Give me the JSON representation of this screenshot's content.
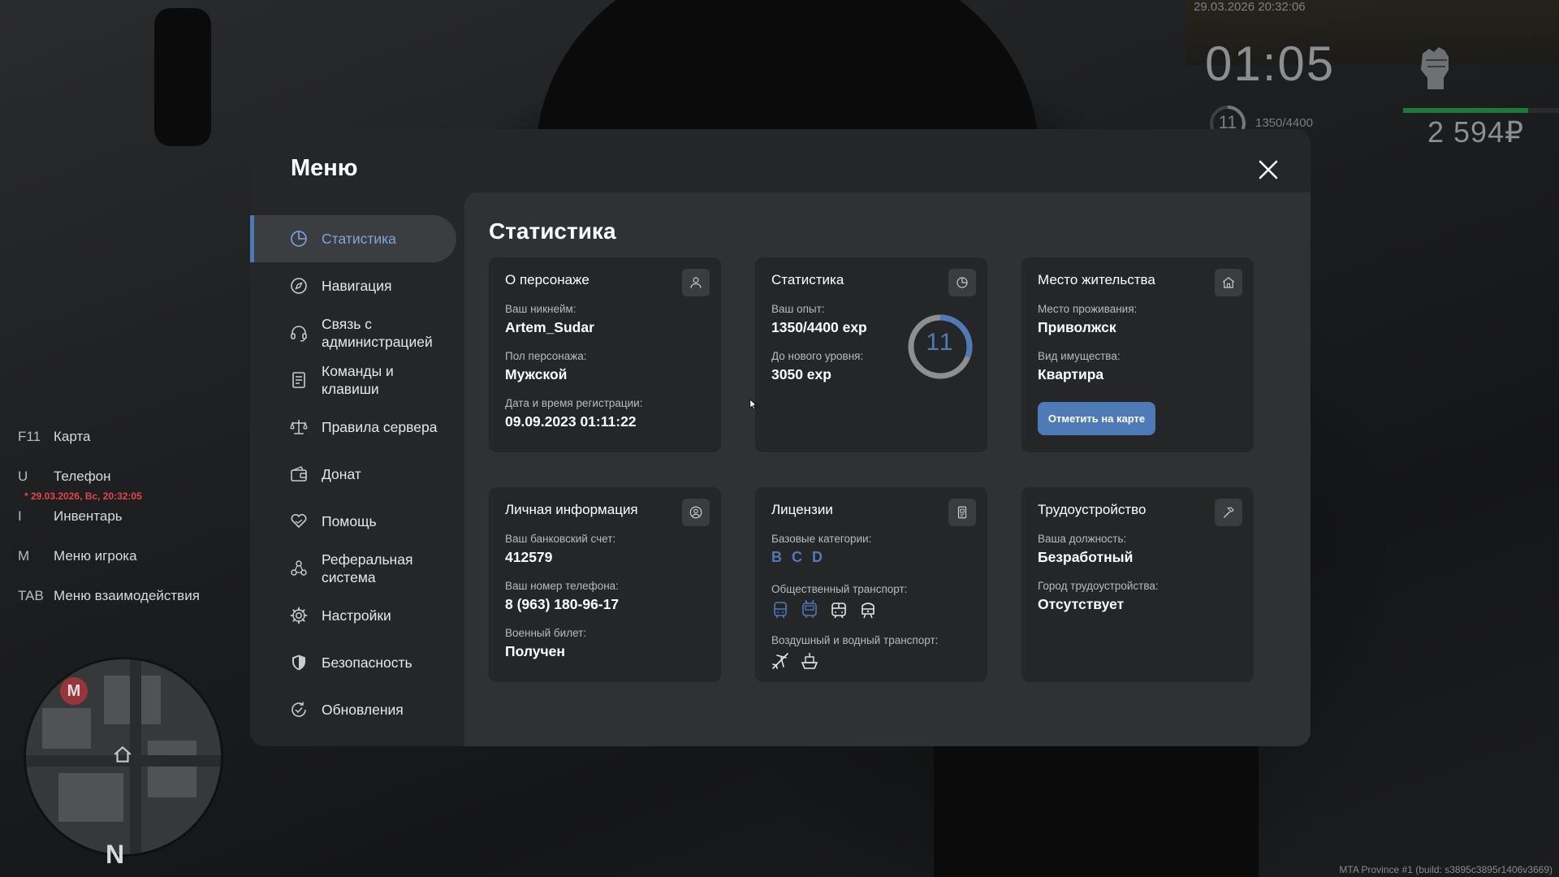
{
  "hud": {
    "datetime": "29.03.2026 20:32:06",
    "clock": "01:05",
    "level": "11",
    "exp": "1350/4400",
    "money": "2 594₽",
    "health_fraction": 0.8
  },
  "hotkeys": [
    {
      "key": "F11",
      "label": "Карта"
    },
    {
      "key": "U",
      "label": "Телефон"
    },
    {
      "key": "I",
      "label": "Инвентарь"
    },
    {
      "key": "M",
      "label": "Меню игрока"
    },
    {
      "key": "TAB",
      "label": "Меню взаимодействия"
    }
  ],
  "hotkey_note": "* 29.03.2026, Вс, 20:32:05",
  "minimap": {
    "metro_label": "M",
    "compass": "N"
  },
  "build_info": "MTA Province #1 (build: s3895c3895r1406v3669)",
  "menu": {
    "title": "Меню",
    "close_icon": "close-icon",
    "nav": [
      {
        "label": "Статистика",
        "icon": "pie-chart-icon",
        "active": true
      },
      {
        "label": "Навигация",
        "icon": "compass-icon"
      },
      {
        "label": "Связь с\nадминистрацией",
        "icon": "headset-icon"
      },
      {
        "label": "Команды и\nклавиши",
        "icon": "document-list-icon"
      },
      {
        "label": "Правила сервера",
        "icon": "scales-icon"
      },
      {
        "label": "Донат",
        "icon": "wallet-icon"
      },
      {
        "label": "Помощь",
        "icon": "heart-hands-icon"
      },
      {
        "label": "Реферальная\nсистема",
        "icon": "people-network-icon"
      },
      {
        "label": "Настройки",
        "icon": "gear-icon"
      },
      {
        "label": "Безопасность",
        "icon": "shield-icon"
      },
      {
        "label": "Обновления",
        "icon": "refresh-check-icon"
      }
    ]
  },
  "content": {
    "title": "Статистика",
    "about": {
      "title": "О персонаже",
      "icon": "user-icon",
      "nick_label": "Ваш никнейм:",
      "nick": "Artem_Sudar",
      "gender_label": "Пол персонажа:",
      "gender": "Мужской",
      "reg_label": "Дата и время регистрации:",
      "reg": "09.09.2023 01:11:22"
    },
    "stats": {
      "title": "Статистика",
      "icon": "pie-chart-icon",
      "exp_label": "Ваш опыт:",
      "exp": "1350/4400 exp",
      "next_label": "До нового уровня:",
      "next": "3050 exp",
      "level": "11",
      "progress": 0.307
    },
    "residence": {
      "title": "Место жительства",
      "icon": "house-icon",
      "place_label": "Место проживания:",
      "place": "Приволжск",
      "type_label": "Вид имущества:",
      "type": "Квартира",
      "button": "Отметить на карте"
    },
    "personal": {
      "title": "Личная информация",
      "icon": "user-circle-icon",
      "bank_label": "Ваш банковский счет:",
      "bank": "412579",
      "phone_label": "Ваш номер телефона:",
      "phone": "8 (963) 180-96-17",
      "military_label": "Военный билет:",
      "military": "Получен"
    },
    "licenses": {
      "title": "Лицензии",
      "icon": "license-card-icon",
      "base_label": "Базовые категории:",
      "categories": [
        "B",
        "C",
        "D"
      ],
      "public_label": "Общественный транспорт:",
      "public_icons": [
        "bus-icon",
        "trolleybus-icon",
        "tram-icon",
        "train-icon"
      ],
      "air_label": "Воздушный и водный транспорт:",
      "air_icons": [
        "airplane-icon",
        "boat-icon"
      ]
    },
    "job": {
      "title": "Трудоустройство",
      "icon": "hammer-icon",
      "position_label": "Ваша должность:",
      "position": "Безработный",
      "city_label": "Город трудоустройства:",
      "city": "Отсутствует"
    }
  }
}
